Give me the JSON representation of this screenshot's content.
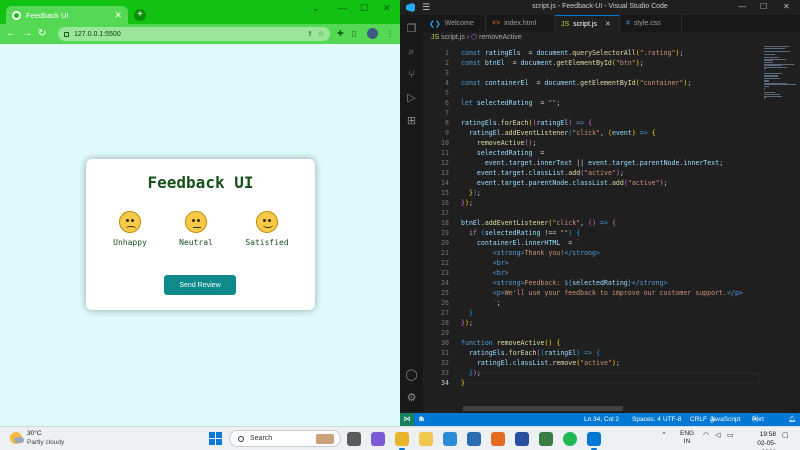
{
  "browser": {
    "tab_title": "Feedback UI",
    "new_tab": "+",
    "url": "127.0.0.1:5500"
  },
  "feedback": {
    "title": "Feedback UI",
    "ratings": [
      {
        "label": "Unhappy",
        "emoji": "sad-face-emoji"
      },
      {
        "label": "Neutral",
        "emoji": "neutral-face-emoji"
      },
      {
        "label": "Satisfied",
        "emoji": "smiling-face-emoji"
      }
    ],
    "button_label": "Send Review"
  },
  "vscode": {
    "window_title": "script.js - Feedback-UI - Visual Studio Code",
    "tabs": [
      {
        "label": "Welcome",
        "icon": "vscode-icon",
        "icon_color": "#23a9f2"
      },
      {
        "label": "index.html",
        "icon": "html-icon",
        "icon_color": "#e37933"
      },
      {
        "label": "script.js",
        "icon": "js-icon",
        "icon_color": "#cbcb41",
        "active": true
      },
      {
        "label": "style.css",
        "icon": "css-icon",
        "icon_color": "#519aba"
      }
    ],
    "breadcrumb": {
      "file": "script.js",
      "symbol": "removeActive"
    },
    "code_lines": [
      [
        [
          "kw",
          "const "
        ],
        [
          "pr",
          "ratingEls"
        ],
        [
          "",
          "  = "
        ],
        [
          "pr",
          "document"
        ],
        [
          "",
          "."
        ],
        [
          "fn",
          "querySelectorAll"
        ],
        [
          "br1",
          "("
        ],
        [
          "str",
          "\".rating\""
        ],
        [
          "br1",
          ")"
        ],
        [
          "",
          ";"
        ]
      ],
      [
        [
          "kw",
          "const "
        ],
        [
          "pr",
          "btnEl"
        ],
        [
          "",
          "  = "
        ],
        [
          "pr",
          "document"
        ],
        [
          "",
          "."
        ],
        [
          "fn",
          "getElementById"
        ],
        [
          "br1",
          "("
        ],
        [
          "str",
          "\"btn\""
        ],
        [
          "br1",
          ")"
        ],
        [
          "",
          ";"
        ]
      ],
      [],
      [
        [
          "kw",
          "const "
        ],
        [
          "pr",
          "containerEl"
        ],
        [
          "",
          "  = "
        ],
        [
          "pr",
          "document"
        ],
        [
          "",
          "."
        ],
        [
          "fn",
          "getElementById"
        ],
        [
          "br1",
          "("
        ],
        [
          "str",
          "\"container\""
        ],
        [
          "br1",
          ")"
        ],
        [
          "",
          ";"
        ]
      ],
      [],
      [
        [
          "kw",
          "let "
        ],
        [
          "pr",
          "selectedRating"
        ],
        [
          "",
          "  = "
        ],
        [
          "str",
          "\"\""
        ],
        [
          "",
          ";"
        ]
      ],
      [],
      [
        [
          "pr",
          "ratingEls"
        ],
        [
          "",
          "."
        ],
        [
          "fn",
          "forEach"
        ],
        [
          "br1",
          "("
        ],
        [
          "br2",
          "("
        ],
        [
          "pr",
          "ratingEl"
        ],
        [
          "br2",
          ")"
        ],
        [
          "kw",
          " => "
        ],
        [
          "br2",
          "{"
        ]
      ],
      [
        [
          "",
          "  "
        ],
        [
          "pr",
          "ratingEl"
        ],
        [
          "",
          "."
        ],
        [
          "fn",
          "addEventListener"
        ],
        [
          "br3",
          "("
        ],
        [
          "str",
          "\"click\""
        ],
        [
          "",
          ", "
        ],
        [
          "br1",
          "("
        ],
        [
          "pr",
          "event"
        ],
        [
          "br1",
          ")"
        ],
        [
          "kw",
          " => "
        ],
        [
          "br1",
          "{"
        ]
      ],
      [
        [
          "",
          "    "
        ],
        [
          "fn",
          "removeActive"
        ],
        [
          "br2",
          "("
        ],
        [
          "br2",
          ")"
        ],
        [
          "",
          ";"
        ]
      ],
      [
        [
          "",
          "    "
        ],
        [
          "pr",
          "selectedRating"
        ],
        [
          "",
          "  ="
        ]
      ],
      [
        [
          "",
          "      "
        ],
        [
          "pr",
          "event"
        ],
        [
          "",
          "."
        ],
        [
          "pr",
          "target"
        ],
        [
          "",
          "."
        ],
        [
          "pr",
          "innerText"
        ],
        [
          "",
          " || "
        ],
        [
          "pr",
          "event"
        ],
        [
          "",
          "."
        ],
        [
          "pr",
          "target"
        ],
        [
          "",
          "."
        ],
        [
          "pr",
          "parentNode"
        ],
        [
          "",
          "."
        ],
        [
          "pr",
          "innerText"
        ],
        [
          "",
          ";"
        ]
      ],
      [
        [
          "",
          "    "
        ],
        [
          "pr",
          "event"
        ],
        [
          "",
          "."
        ],
        [
          "pr",
          "target"
        ],
        [
          "",
          "."
        ],
        [
          "pr",
          "classList"
        ],
        [
          "",
          "."
        ],
        [
          "fn",
          "add"
        ],
        [
          "br2",
          "("
        ],
        [
          "str",
          "\"active\""
        ],
        [
          "br2",
          ")"
        ],
        [
          "",
          ";"
        ]
      ],
      [
        [
          "",
          "    "
        ],
        [
          "pr",
          "event"
        ],
        [
          "",
          "."
        ],
        [
          "pr",
          "target"
        ],
        [
          "",
          "."
        ],
        [
          "pr",
          "parentNode"
        ],
        [
          "",
          "."
        ],
        [
          "pr",
          "classList"
        ],
        [
          "",
          "."
        ],
        [
          "fn",
          "add"
        ],
        [
          "br2",
          "("
        ],
        [
          "str",
          "\"active\""
        ],
        [
          "br2",
          ")"
        ],
        [
          "",
          ";"
        ]
      ],
      [
        [
          "",
          "  "
        ],
        [
          "br1",
          "}"
        ],
        [
          "br3",
          ")"
        ],
        [
          "",
          ";"
        ]
      ],
      [
        [
          "br2",
          "}"
        ],
        [
          "br1",
          ")"
        ],
        [
          "",
          ";"
        ]
      ],
      [],
      [
        [
          "pr",
          "btnEl"
        ],
        [
          "",
          "."
        ],
        [
          "fn",
          "addEventListener"
        ],
        [
          "br1",
          "("
        ],
        [
          "str",
          "\"click\""
        ],
        [
          "",
          ", "
        ],
        [
          "br2",
          "("
        ],
        [
          "br2",
          ")"
        ],
        [
          "kw",
          " => "
        ],
        [
          "br2",
          "{"
        ]
      ],
      [
        [
          "",
          "  "
        ],
        [
          "ctl",
          "if "
        ],
        [
          "br3",
          "("
        ],
        [
          "pr",
          "selectedRating"
        ],
        [
          "",
          " !== "
        ],
        [
          "str",
          "\"\""
        ],
        [
          "br3",
          ")"
        ],
        [
          "",
          " "
        ],
        [
          "br3",
          "{"
        ]
      ],
      [
        [
          "",
          "    "
        ],
        [
          "pr",
          "containerEl"
        ],
        [
          "",
          "."
        ],
        [
          "pr",
          "innerHTML"
        ],
        [
          "",
          "  = "
        ],
        [
          "str",
          "`"
        ]
      ],
      [
        [
          "str",
          "        "
        ],
        [
          "tag",
          "<strong>"
        ],
        [
          "str",
          "Thank you!"
        ],
        [
          "tag",
          "</strong>"
        ]
      ],
      [
        [
          "str",
          "        "
        ],
        [
          "tag",
          "<br>"
        ]
      ],
      [
        [
          "str",
          "        "
        ],
        [
          "tag",
          "<br>"
        ]
      ],
      [
        [
          "str",
          "        "
        ],
        [
          "tag",
          "<strong>"
        ],
        [
          "str",
          "Feedback: "
        ],
        [
          "kw",
          "${"
        ],
        [
          "pr",
          "selectedRating"
        ],
        [
          "kw",
          "}"
        ],
        [
          "tag",
          "</strong>"
        ]
      ],
      [
        [
          "str",
          "        "
        ],
        [
          "tag",
          "<p>"
        ],
        [
          "str",
          "We'll use your feedback to improve our customer support."
        ],
        [
          "tag",
          "</p>"
        ]
      ],
      [
        [
          "str",
          "        `"
        ],
        [
          "",
          ";"
        ]
      ],
      [
        [
          "",
          "  "
        ],
        [
          "br3",
          "}"
        ]
      ],
      [
        [
          "br2",
          "}"
        ],
        [
          "br1",
          ")"
        ],
        [
          "",
          ";"
        ]
      ],
      [],
      [
        [
          "kw",
          "function "
        ],
        [
          "fn",
          "removeActive"
        ],
        [
          "br1",
          "("
        ],
        [
          "br1",
          ")"
        ],
        [
          "",
          " "
        ],
        [
          "br1",
          "{"
        ]
      ],
      [
        [
          "",
          "  "
        ],
        [
          "pr",
          "ratingEls"
        ],
        [
          "",
          "."
        ],
        [
          "fn",
          "forEach"
        ],
        [
          "br2",
          "("
        ],
        [
          "br3",
          "("
        ],
        [
          "pr",
          "ratingEl"
        ],
        [
          "br3",
          ")"
        ],
        [
          "kw",
          " => "
        ],
        [
          "br3",
          "{"
        ]
      ],
      [
        [
          "",
          "    "
        ],
        [
          "pr",
          "ratingEl"
        ],
        [
          "",
          "."
        ],
        [
          "pr",
          "classList"
        ],
        [
          "",
          "."
        ],
        [
          "fn",
          "remove"
        ],
        [
          "br1",
          "("
        ],
        [
          "str",
          "\"active\""
        ],
        [
          "br1",
          ")"
        ],
        [
          "",
          ";"
        ]
      ],
      [
        [
          "",
          "  "
        ],
        [
          "br3",
          "}"
        ],
        [
          "br2",
          ")"
        ],
        [
          "",
          ";"
        ]
      ],
      [
        [
          "br1",
          "}"
        ]
      ]
    ],
    "current_line": 34,
    "status": {
      "errors": "0",
      "warnings": "0",
      "position": "Ln 34, Col 2",
      "spaces": "Spaces: 4",
      "encoding": "UTF-8",
      "eol": "CRLF",
      "language": "JavaScript",
      "port": "Port : 5500"
    }
  },
  "taskbar": {
    "weather_temp": "30°C",
    "weather_cond": "Partly cloudy",
    "search_placeholder": "Search",
    "language": "ENG",
    "region": "IN",
    "time": "19:58",
    "date": "02-05-2023"
  },
  "colors": {
    "chrome_green": "#12c212",
    "card_title": "#16521a",
    "button": "#0e8a8a",
    "vs_status": "#0078d4"
  }
}
